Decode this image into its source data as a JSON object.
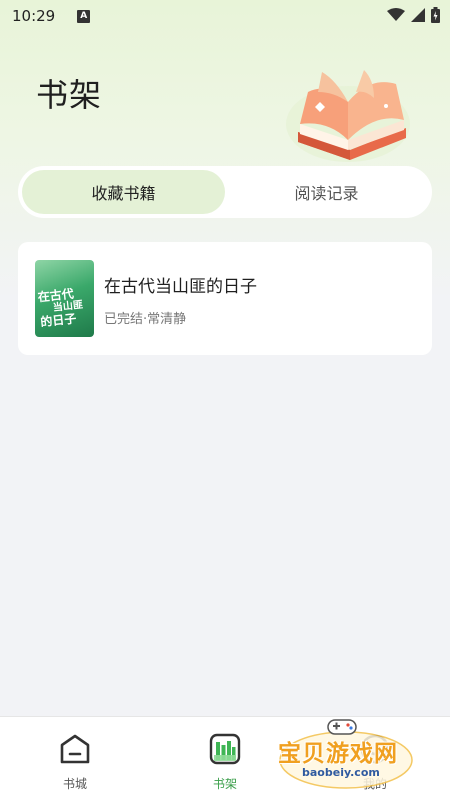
{
  "status_bar": {
    "time": "10:29",
    "notification_badge": "A"
  },
  "header": {
    "title": "书架"
  },
  "tabs": [
    {
      "label": "收藏书籍",
      "active": true
    },
    {
      "label": "阅读记录",
      "active": false
    }
  ],
  "books": [
    {
      "title": "在古代当山匪的日子",
      "meta": "已完结·常清静",
      "cover_text_line1": "在古代",
      "cover_text_line2": "当山匪",
      "cover_text_line3": "的日子"
    }
  ],
  "bottom_nav": {
    "items": [
      {
        "label": "书城",
        "icon": "home-icon",
        "active": false
      },
      {
        "label": "书架",
        "icon": "bookshelf-icon",
        "active": true
      },
      {
        "label": "我的",
        "icon": "profile-icon",
        "active": false
      }
    ]
  },
  "watermark": {
    "text": "宝贝游戏网",
    "url": "baobeiy.com"
  },
  "colors": {
    "accent": "#3a9e4a",
    "tab_active_bg": "#e4f1d6",
    "background": "#f2f3f6"
  }
}
